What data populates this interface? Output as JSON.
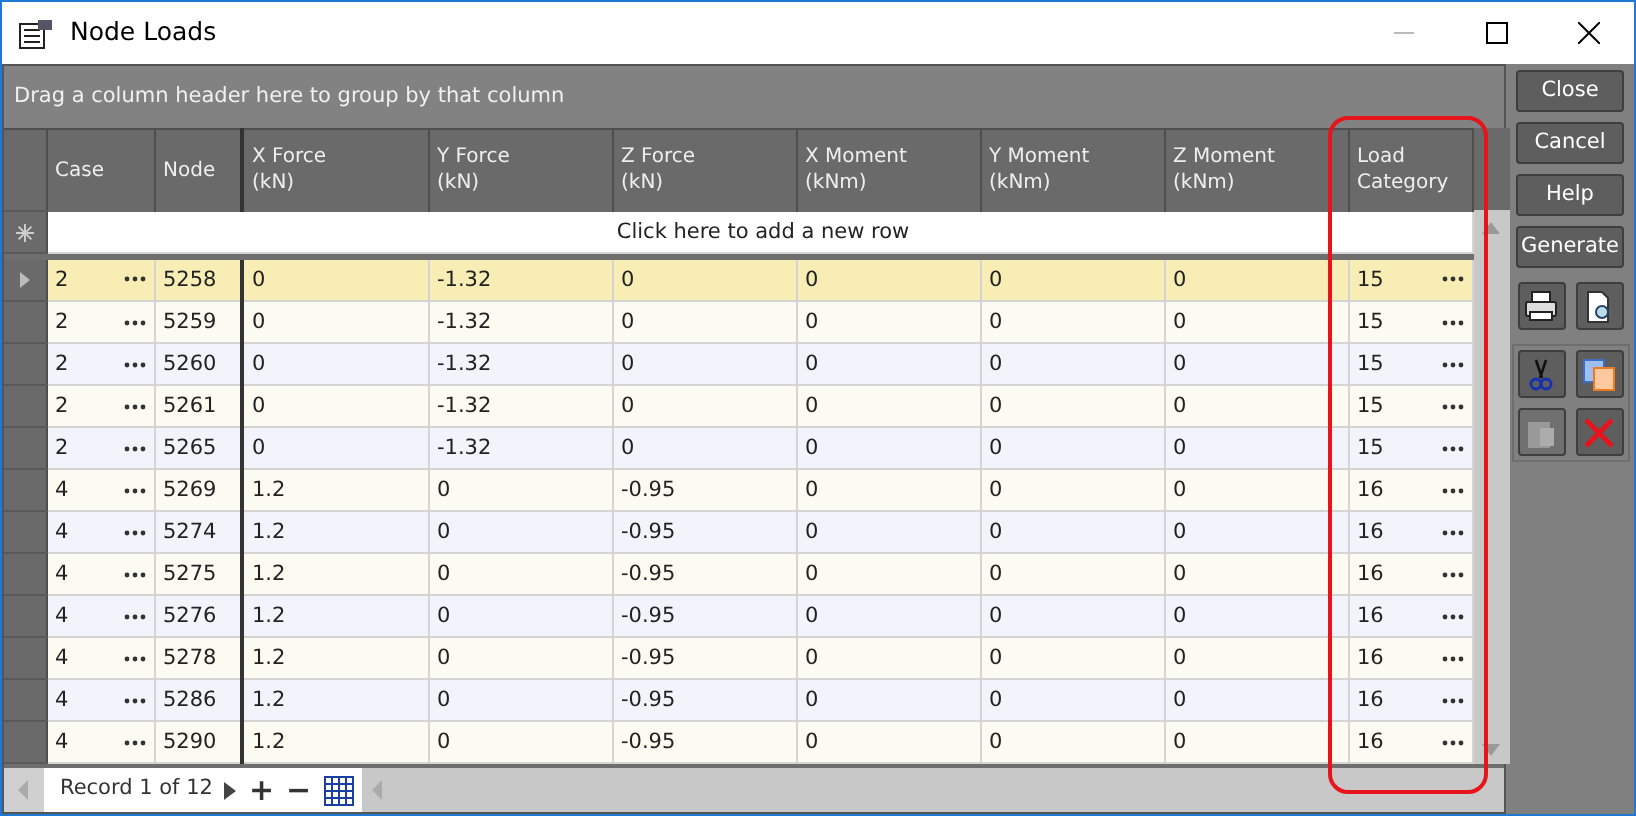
{
  "window": {
    "title": "Node Loads"
  },
  "group_panel": {
    "hint": "Drag a column header here to group by that column"
  },
  "columns": [
    {
      "lines": [
        "Case"
      ],
      "kind": "lookup"
    },
    {
      "lines": [
        "Node"
      ],
      "kind": "key"
    },
    {
      "lines": [
        "X Force",
        "(kN)"
      ],
      "kind": "value"
    },
    {
      "lines": [
        "Y Force",
        "(kN)"
      ],
      "kind": "value"
    },
    {
      "lines": [
        "Z Force",
        "(kN)"
      ],
      "kind": "value"
    },
    {
      "lines": [
        "X Moment",
        "(kNm)"
      ],
      "kind": "value"
    },
    {
      "lines": [
        "Y Moment",
        "(kNm)"
      ],
      "kind": "value"
    },
    {
      "lines": [
        "Z Moment",
        "(kNm)"
      ],
      "kind": "value"
    },
    {
      "lines": [
        "Load",
        "Category"
      ],
      "kind": "lookup"
    }
  ],
  "new_row": {
    "hint": "Click here to add a new row"
  },
  "rows": [
    {
      "selected": true,
      "cells": [
        "2",
        "5258",
        "0",
        "-1.32",
        "0",
        "0",
        "0",
        "0",
        "15"
      ]
    },
    {
      "selected": false,
      "cells": [
        "2",
        "5259",
        "0",
        "-1.32",
        "0",
        "0",
        "0",
        "0",
        "15"
      ]
    },
    {
      "selected": false,
      "cells": [
        "2",
        "5260",
        "0",
        "-1.32",
        "0",
        "0",
        "0",
        "0",
        "15"
      ]
    },
    {
      "selected": false,
      "cells": [
        "2",
        "5261",
        "0",
        "-1.32",
        "0",
        "0",
        "0",
        "0",
        "15"
      ]
    },
    {
      "selected": false,
      "cells": [
        "2",
        "5265",
        "0",
        "-1.32",
        "0",
        "0",
        "0",
        "0",
        "15"
      ]
    },
    {
      "selected": false,
      "cells": [
        "4",
        "5269",
        "1.2",
        "0",
        "-0.95",
        "0",
        "0",
        "0",
        "16"
      ]
    },
    {
      "selected": false,
      "cells": [
        "4",
        "5274",
        "1.2",
        "0",
        "-0.95",
        "0",
        "0",
        "0",
        "16"
      ]
    },
    {
      "selected": false,
      "cells": [
        "4",
        "5275",
        "1.2",
        "0",
        "-0.95",
        "0",
        "0",
        "0",
        "16"
      ]
    },
    {
      "selected": false,
      "cells": [
        "4",
        "5276",
        "1.2",
        "0",
        "-0.95",
        "0",
        "0",
        "0",
        "16"
      ]
    },
    {
      "selected": false,
      "cells": [
        "4",
        "5278",
        "1.2",
        "0",
        "-0.95",
        "0",
        "0",
        "0",
        "16"
      ]
    },
    {
      "selected": false,
      "cells": [
        "4",
        "5286",
        "1.2",
        "0",
        "-0.95",
        "0",
        "0",
        "0",
        "16"
      ]
    },
    {
      "selected": false,
      "cells": [
        "4",
        "5290",
        "1.2",
        "0",
        "-0.95",
        "0",
        "0",
        "0",
        "16"
      ]
    }
  ],
  "navigator": {
    "record": "Record 1 of 12",
    "add": "+",
    "remove": "−"
  },
  "buttons": [
    "Close",
    "Cancel",
    "Help",
    "Generate"
  ],
  "tool_buttons": [
    {
      "kind": "print",
      "disabled": false
    },
    {
      "kind": "preview",
      "disabled": false
    },
    {
      "kind": "cut",
      "disabled": false
    },
    {
      "kind": "copy",
      "disabled": false
    },
    {
      "kind": "paste",
      "disabled": true
    },
    {
      "kind": "delete",
      "disabled": false
    }
  ]
}
